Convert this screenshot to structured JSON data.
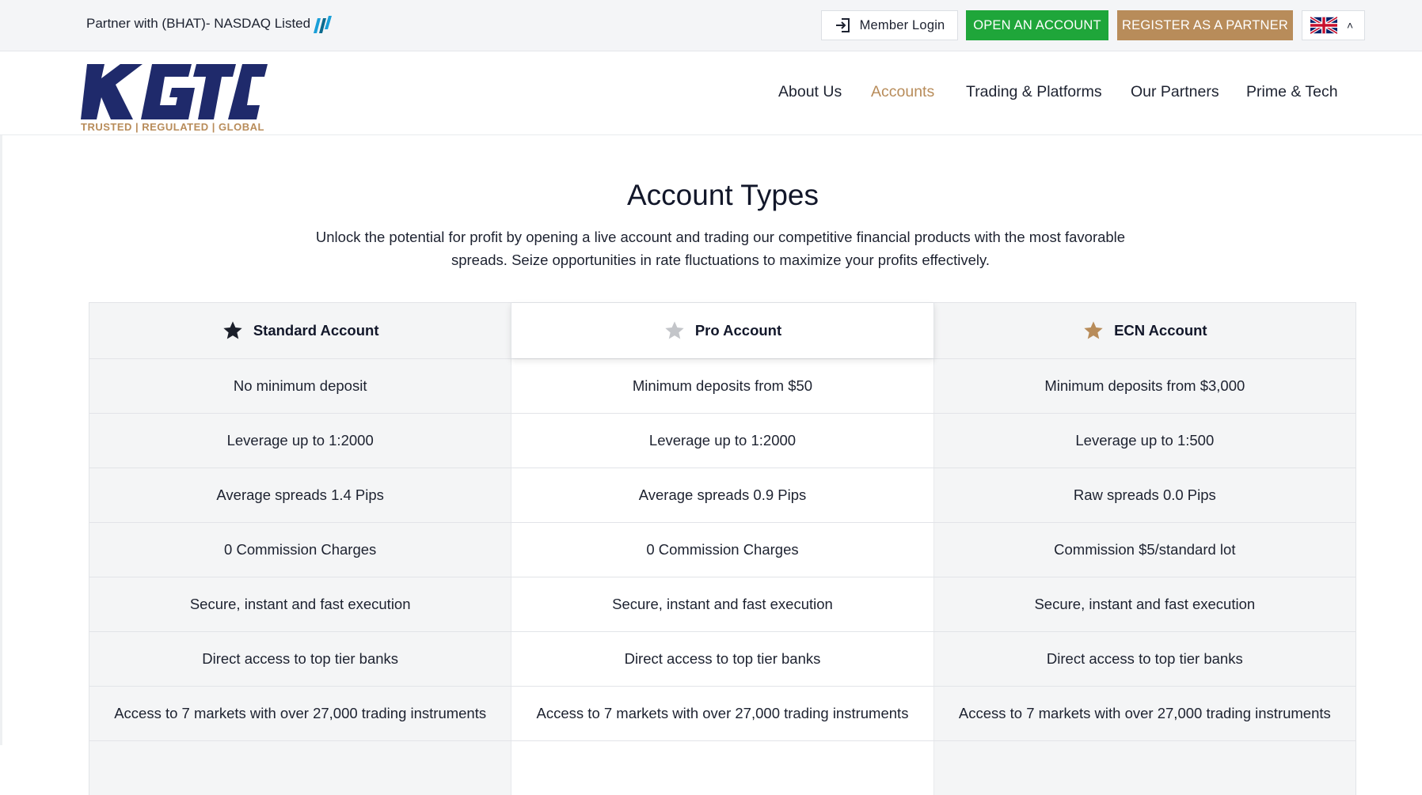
{
  "topbar": {
    "partner_text": "Partner with (BHAT)- NASDAQ Listed",
    "member_login": "Member Login",
    "open_account": "OPEN AN ACCOUNT",
    "register_partner": "REGISTER AS A PARTNER",
    "language_flag": "uk-flag-icon"
  },
  "logo": {
    "mark": "KGTC",
    "tagline": "TRUSTED | REGULATED | GLOBAL"
  },
  "nav": {
    "items": [
      {
        "label": "About Us",
        "active": false
      },
      {
        "label": "Accounts",
        "active": true
      },
      {
        "label": "Trading & Platforms",
        "active": false
      },
      {
        "label": "Our Partners",
        "active": false
      },
      {
        "label": "Prime & Tech",
        "active": false
      }
    ]
  },
  "main": {
    "title": "Account Types",
    "intro_line1": "Unlock the potential for profit by opening a live account and trading our competitive financial products with the most favorable",
    "intro_line2": "spreads. Seize opportunities in rate fluctuations to maximize your profits effectively."
  },
  "table": {
    "columns": [
      {
        "label": "Standard Account",
        "star_color": "#1b1f2a"
      },
      {
        "label": "Pro Account",
        "star_color": "#c3c5c9"
      },
      {
        "label": "ECN Account",
        "star_color": "#b88c5a"
      }
    ],
    "rows": [
      [
        "No minimum deposit",
        "Minimum deposits from $50",
        "Minimum deposits from $3,000"
      ],
      [
        "Leverage up to 1:2000",
        "Leverage up to 1:2000",
        "Leverage up to 1:500"
      ],
      [
        "Average spreads 1.4 Pips",
        "Average spreads 0.9 Pips",
        "Raw spreads 0.0 Pips"
      ],
      [
        "0 Commission Charges",
        "0 Commission Charges",
        "Commission $5/standard lot"
      ],
      [
        "Secure, instant and fast execution",
        "Secure, instant and fast execution",
        "Secure, instant and fast execution"
      ],
      [
        "Direct access to top tier banks",
        "Direct access to top tier banks",
        "Direct access to top tier banks"
      ],
      [
        "Access to 7 markets with over 27,000 trading instruments",
        "Access to 7 markets with over 27,000 trading instruments",
        "Access to 7 markets with over 27,000 trading instruments"
      ],
      [
        "",
        "",
        ""
      ]
    ]
  },
  "colors": {
    "accent_gold": "#b88c5a",
    "green": "#1fa63a",
    "navy": "#1f2a6b"
  }
}
